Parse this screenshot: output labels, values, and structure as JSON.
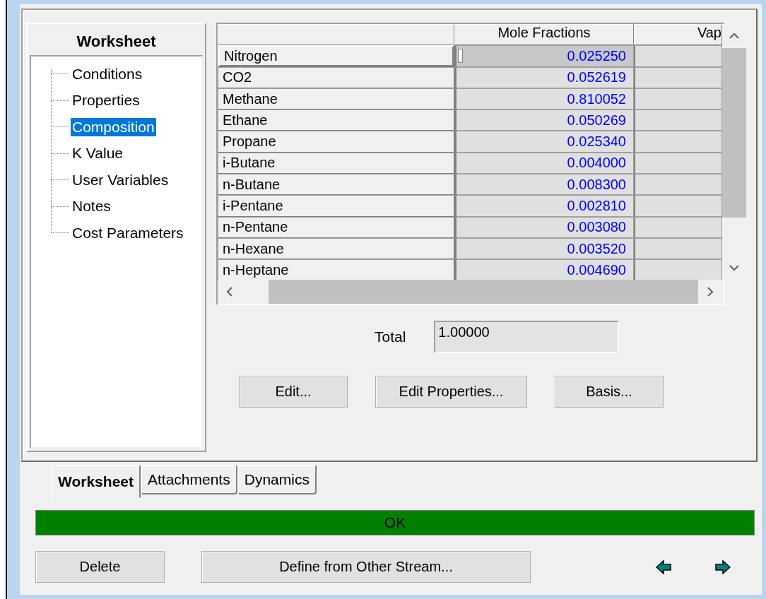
{
  "tree": {
    "title": "Worksheet",
    "items": [
      {
        "label": "Conditions",
        "selected": false
      },
      {
        "label": "Properties",
        "selected": false
      },
      {
        "label": "Composition",
        "selected": true
      },
      {
        "label": "K Value",
        "selected": false
      },
      {
        "label": "User Variables",
        "selected": false
      },
      {
        "label": "Notes",
        "selected": false
      },
      {
        "label": "Cost Parameters",
        "selected": false
      }
    ]
  },
  "grid": {
    "columns": [
      "Mole Fractions",
      "Vap"
    ],
    "rows": [
      {
        "name": "Nitrogen",
        "value": "0.025250",
        "selected": true
      },
      {
        "name": "CO2",
        "value": "0.052619",
        "selected": false
      },
      {
        "name": "Methane",
        "value": "0.810052",
        "selected": false
      },
      {
        "name": "Ethane",
        "value": "0.050269",
        "selected": false
      },
      {
        "name": "Propane",
        "value": "0.025340",
        "selected": false
      },
      {
        "name": "i-Butane",
        "value": "0.004000",
        "selected": false
      },
      {
        "name": "n-Butane",
        "value": "0.008300",
        "selected": false
      },
      {
        "name": "i-Pentane",
        "value": "0.002810",
        "selected": false
      },
      {
        "name": "n-Pentane",
        "value": "0.003080",
        "selected": false
      },
      {
        "name": "n-Hexane",
        "value": "0.003520",
        "selected": false
      },
      {
        "name": "n-Heptane",
        "value": "0.004690",
        "selected": false
      }
    ]
  },
  "total": {
    "label": "Total",
    "value": "1.00000"
  },
  "actions": [
    "Edit...",
    "Edit Properties...",
    "Basis..."
  ],
  "tabs": [
    {
      "label": "Worksheet",
      "selected": true
    },
    {
      "label": "Attachments",
      "selected": false
    },
    {
      "label": "Dynamics",
      "selected": false
    }
  ],
  "status": {
    "text": "OK",
    "color": "#008000"
  },
  "footer": {
    "buttons": [
      "Delete",
      "Define from Other Stream..."
    ]
  }
}
